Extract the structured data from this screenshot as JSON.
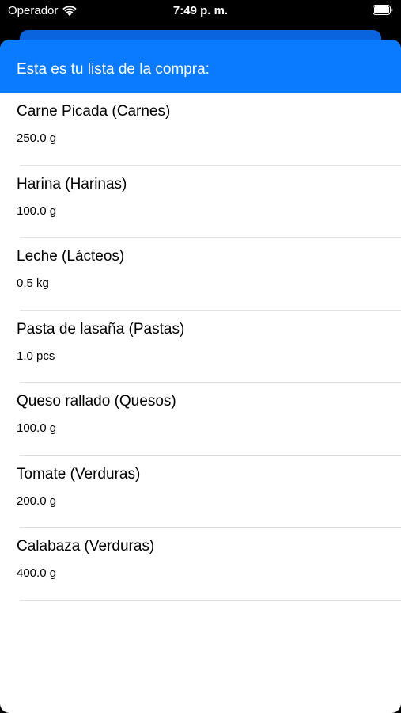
{
  "status_bar": {
    "carrier": "Operador",
    "time": "7:49 p. m."
  },
  "header": {
    "title": "Esta es tu lista de la compra:"
  },
  "colors": {
    "accent": "#0a7aff",
    "background": "#000000",
    "sheet": "#ffffff"
  },
  "shopping_list": [
    {
      "name": "Carne Picada (Carnes)",
      "qty": "250.0 g"
    },
    {
      "name": "Harina (Harinas)",
      "qty": "100.0 g"
    },
    {
      "name": "Leche (Lácteos)",
      "qty": "0.5 kg"
    },
    {
      "name": "Pasta de lasaña (Pastas)",
      "qty": "1.0 pcs"
    },
    {
      "name": "Queso rallado (Quesos)",
      "qty": "100.0 g"
    },
    {
      "name": "Tomate (Verduras)",
      "qty": "200.0 g"
    },
    {
      "name": "Calabaza (Verduras)",
      "qty": "400.0 g"
    }
  ]
}
